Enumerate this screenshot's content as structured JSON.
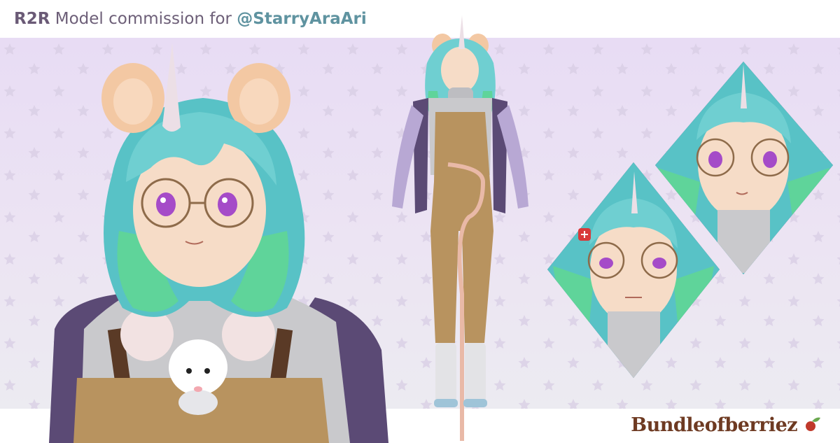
{
  "header": {
    "prefix": "R2R",
    "middle": " Model commission for ",
    "handle": "@StarryAraAri"
  },
  "brand": {
    "logo_text": "Bundleofberriez"
  },
  "colors": {
    "background_top": "#e8dcf4",
    "background_bottom": "#ecebf1",
    "hair": "#6fcfd1",
    "hair_tips": "#5fd49a",
    "ears": "#f3c8a3",
    "sweater": "#c9c9cc",
    "overalls": "#b8935f",
    "jacket": "#5b4a75",
    "eyes": "#a54bc8",
    "logo": "#6e3a22"
  },
  "icons": {
    "background_pattern": "star-pattern-icon",
    "logo_mark": "berry-leaf-icon",
    "anger_mark": "anger-mark-icon"
  }
}
